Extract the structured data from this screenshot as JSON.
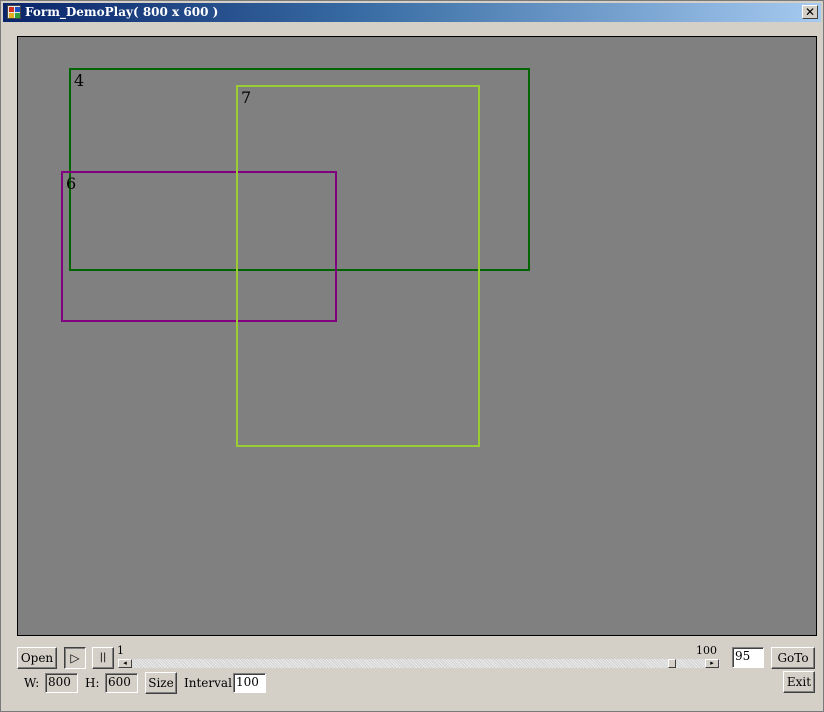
{
  "window": {
    "title": "Form_DemoPlay( 800 x 600 )",
    "close_symbol": "✕"
  },
  "canvas": {
    "background": "#808080",
    "regions": [
      {
        "id": "4",
        "color": "#006400"
      },
      {
        "id": "6",
        "color": "#800080"
      },
      {
        "id": "7",
        "color": "#9acd32"
      }
    ]
  },
  "controls": {
    "open_label": "Open",
    "play_symbol": "▷",
    "pause_symbol": "||",
    "slider": {
      "min_label": "1",
      "max_label": "100",
      "value": 95,
      "left_arrow": "◂",
      "right_arrow": "▸"
    },
    "frame_value": "95",
    "goto_label": "GoTo",
    "width_label": "W:",
    "width_value": "800",
    "height_label": "H:",
    "height_value": "600",
    "size_label": "Size",
    "interval_label": "Interval:",
    "interval_value": "100",
    "exit_label": "Exit"
  }
}
